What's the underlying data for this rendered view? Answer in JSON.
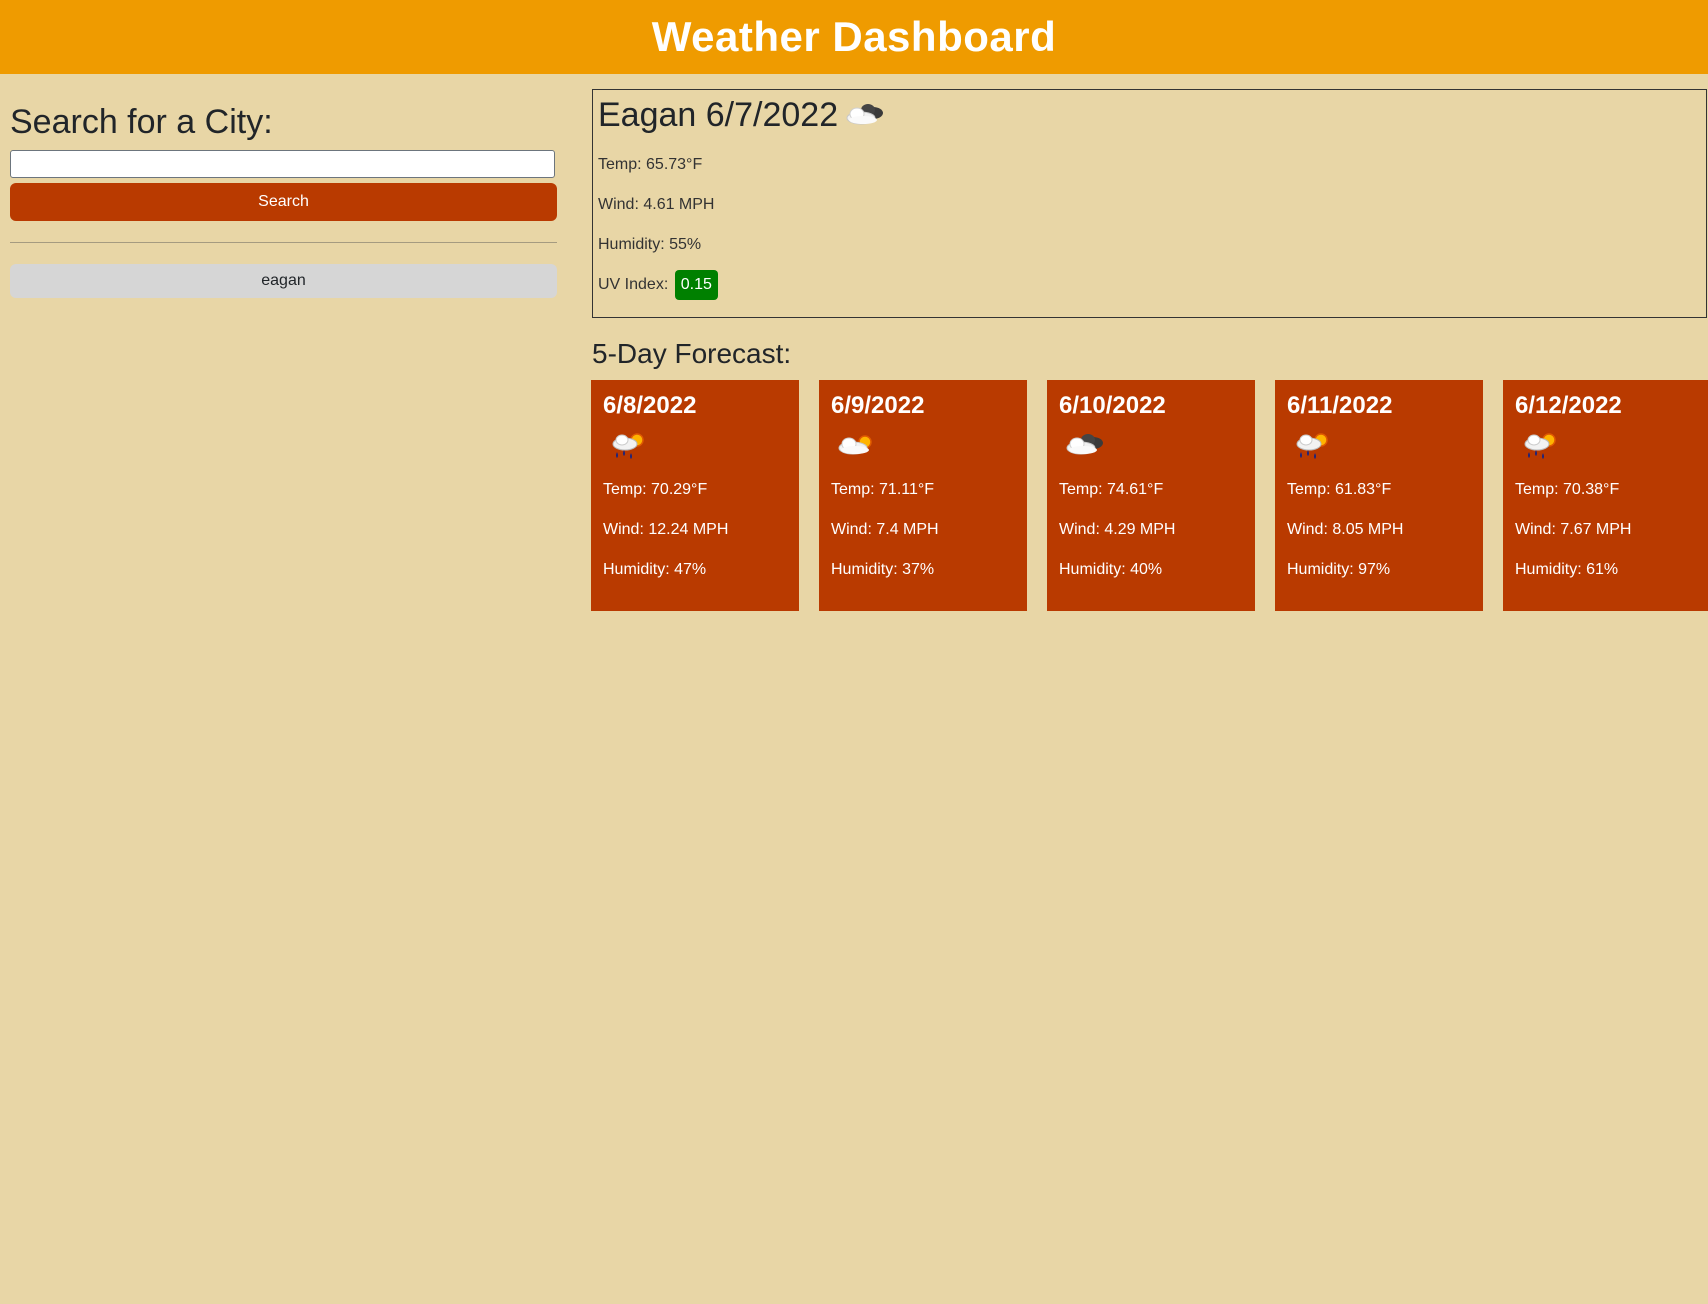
{
  "header": {
    "title": "Weather Dashboard"
  },
  "sidebar": {
    "search_heading": "Search for a City:",
    "search_input_value": "",
    "search_input_placeholder": "",
    "search_button_label": "Search",
    "history": [
      {
        "label": "eagan"
      }
    ]
  },
  "current": {
    "title": "Eagan 6/7/2022",
    "icon": "few-clouds-night-icon",
    "temp": "Temp: 65.73°F",
    "wind": "Wind: 4.61 MPH",
    "humidity": "Humidity: 55%",
    "uv_label": "UV Index:",
    "uv_value": "0.15",
    "uv_color": "#008000"
  },
  "forecast": {
    "title": "5-Day Forecast:",
    "days": [
      {
        "date": "6/8/2022",
        "icon": "rain-sun-icon",
        "temp": "Temp: 70.29°F",
        "wind": "Wind: 12.24 MPH",
        "humidity": "Humidity: 47%"
      },
      {
        "date": "6/9/2022",
        "icon": "few-clouds-day-icon",
        "temp": "Temp: 71.11°F",
        "wind": "Wind: 7.4 MPH",
        "humidity": "Humidity: 37%"
      },
      {
        "date": "6/10/2022",
        "icon": "few-clouds-night-icon",
        "temp": "Temp: 74.61°F",
        "wind": "Wind: 4.29 MPH",
        "humidity": "Humidity: 40%"
      },
      {
        "date": "6/11/2022",
        "icon": "rain-sun-icon",
        "temp": "Temp: 61.83°F",
        "wind": "Wind: 8.05 MPH",
        "humidity": "Humidity: 97%"
      },
      {
        "date": "6/12/2022",
        "icon": "rain-sun-icon",
        "temp": "Temp: 70.38°F",
        "wind": "Wind: 7.67 MPH",
        "humidity": "Humidity: 61%"
      }
    ]
  },
  "colors": {
    "header_bg": "#ef9b00",
    "page_bg": "#e8d6a6",
    "accent": "#b93a00",
    "history_bg": "#d6d6d6"
  }
}
